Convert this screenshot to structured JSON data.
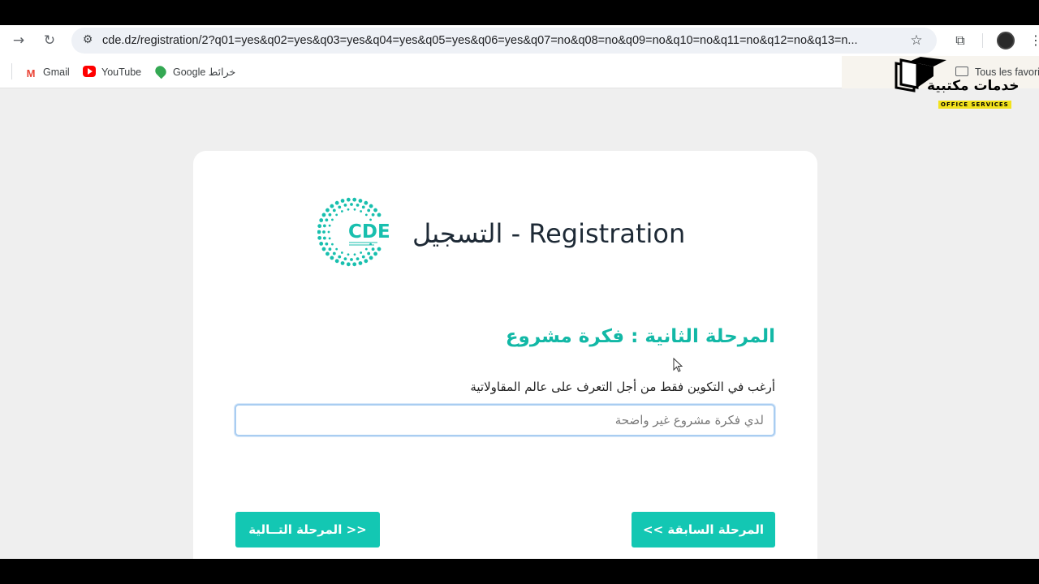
{
  "browser": {
    "url": "cde.dz/registration/2?q01=yes&q02=yes&q03=yes&q04=yes&q05=yes&q06=yes&q07=no&q08=no&q09=no&q10=no&q11=no&q12=no&q13=n...",
    "bookmarks": [
      {
        "label": "Gmail"
      },
      {
        "label": "YouTube"
      },
      {
        "label": "Google خرائط"
      }
    ],
    "all_bookmarks_label": "Tous les favori"
  },
  "page": {
    "heading": "التسجيل - Registration",
    "logo_text": "CDE",
    "stage_title": "المرحلة الثانية : فكرة مشروع",
    "question_label": "أرغب في التكوين فقط من أجل التعرف على عالم المقاولاتية",
    "select_value": "لدي فكرة مشروع غير واضحة",
    "next_button": "المرحلة التــالية >>",
    "prev_button": "<< المرحلة السابقة"
  },
  "watermark": {
    "title": "خدمات مكتبية",
    "subtitle": "OFFICE SERVICES"
  },
  "colors": {
    "accent": "#13c7b3",
    "stage_title": "#12b8a6",
    "page_bg": "#efefef"
  }
}
